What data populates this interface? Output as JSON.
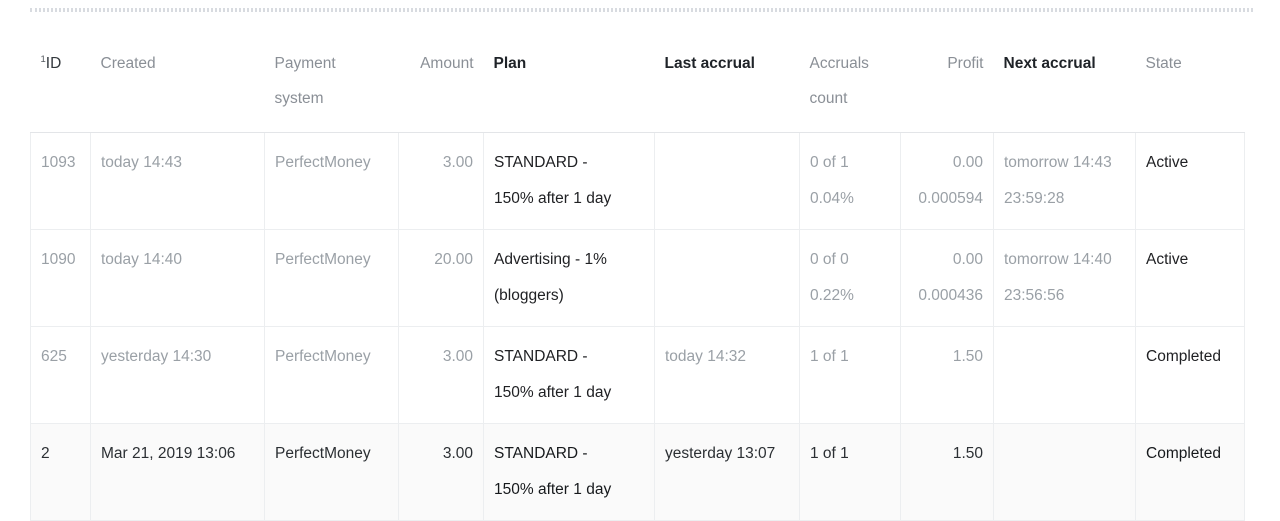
{
  "top_rule": {
    "style": "dotted-double"
  },
  "table": {
    "columns": [
      {
        "key": "id",
        "label": "ID",
        "sup": "1",
        "align": "left",
        "emphasis": "semi"
      },
      {
        "key": "created",
        "label": "Created",
        "align": "left",
        "emphasis": "muted"
      },
      {
        "key": "payment_system",
        "label": "Payment system",
        "align": "left",
        "emphasis": "muted"
      },
      {
        "key": "amount",
        "label": "Amount",
        "align": "right",
        "emphasis": "muted"
      },
      {
        "key": "plan",
        "label": "Plan",
        "align": "left",
        "emphasis": "dark"
      },
      {
        "key": "last_accrual",
        "label": "Last accrual",
        "align": "left",
        "emphasis": "dark"
      },
      {
        "key": "accruals_count",
        "label": "Accruals count",
        "align": "left",
        "emphasis": "muted"
      },
      {
        "key": "profit",
        "label": "Profit",
        "align": "right",
        "emphasis": "muted"
      },
      {
        "key": "next_accrual",
        "label": "Next accrual",
        "align": "left",
        "emphasis": "dark"
      },
      {
        "key": "state",
        "label": "State",
        "align": "left",
        "emphasis": "muted"
      }
    ],
    "rows": [
      {
        "id": "1093",
        "created": "today 14:43",
        "payment_system": "PerfectMoney",
        "amount": "3.00",
        "plan_line1": "STANDARD -",
        "plan_line2": "150% after 1 day",
        "last_accrual": "",
        "accruals_count": "0 of 1",
        "accruals_percent": "0.04%",
        "profit": "0.00",
        "profit_sub": "0.000594",
        "next_accrual_line1": "tomorrow 14:43",
        "next_accrual_line2": "23:59:28",
        "state": "Active",
        "highlighted": false
      },
      {
        "id": "1090",
        "created": "today 14:40",
        "payment_system": "PerfectMoney",
        "amount": "20.00",
        "plan_line1": "Advertising - 1%",
        "plan_line2": "(bloggers)",
        "last_accrual": "",
        "accruals_count": "0 of 0",
        "accruals_percent": "0.22%",
        "profit": "0.00",
        "profit_sub": "0.000436",
        "next_accrual_line1": "tomorrow 14:40",
        "next_accrual_line2": "23:56:56",
        "state": "Active",
        "highlighted": false
      },
      {
        "id": "625",
        "created": "yesterday 14:30",
        "payment_system": "PerfectMoney",
        "amount": "3.00",
        "plan_line1": "STANDARD -",
        "plan_line2": "150% after 1 day",
        "last_accrual": "today 14:32",
        "accruals_count": "1 of 1",
        "accruals_percent": "",
        "profit": "1.50",
        "profit_sub": "",
        "next_accrual_line1": "",
        "next_accrual_line2": "",
        "state": "Completed",
        "highlighted": false
      },
      {
        "id": "2",
        "created": "Mar 21, 2019 13:06",
        "payment_system": "PerfectMoney",
        "amount": "3.00",
        "plan_line1": "STANDARD -",
        "plan_line2": "150% after 1 day",
        "last_accrual": "yesterday 13:07",
        "accruals_count": "1 of 1",
        "accruals_percent": "",
        "profit": "1.50",
        "profit_sub": "",
        "next_accrual_line1": "",
        "next_accrual_line2": "",
        "state": "Completed",
        "highlighted": true
      }
    ]
  },
  "colors": {
    "muted_text": "#9aa0a6",
    "dark_text": "#202124",
    "border": "#eceef0",
    "header_border": "#e3e5e8",
    "row_highlight": "#fafafa",
    "dotted_rule": "#d8dbe0"
  }
}
